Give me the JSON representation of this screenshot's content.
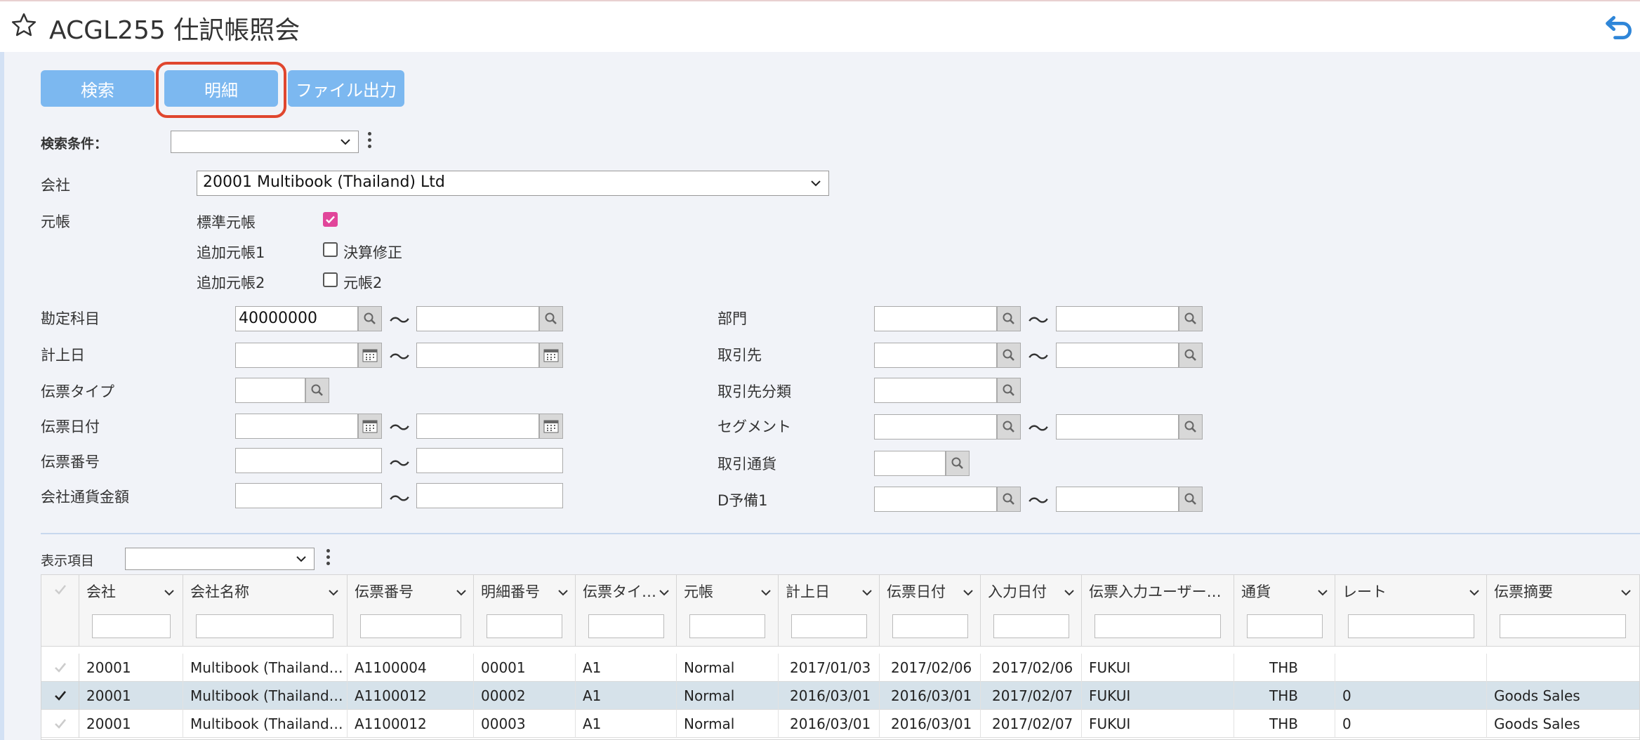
{
  "header": {
    "title": "ACGL255 仕訳帳照会"
  },
  "toolbar": {
    "search": "検索",
    "detail": "明細",
    "export": "ファイル出力"
  },
  "criteria": {
    "label": "検索条件：",
    "value": ""
  },
  "company": {
    "label": "会社",
    "value": "20001 Multibook (Thailand) Ltd"
  },
  "ledger": {
    "label": "元帳",
    "rows": [
      {
        "name": "標準元帳",
        "option": "",
        "checked": true
      },
      {
        "name": "追加元帳1",
        "option": "決算修正",
        "checked": false
      },
      {
        "name": "追加元帳2",
        "option": "元帳2",
        "checked": false
      }
    ]
  },
  "filters_left": [
    {
      "label": "勘定科目",
      "from": "40000000",
      "to": "",
      "type": "lookup",
      "range": true
    },
    {
      "label": "計上日",
      "from": "",
      "to": "",
      "type": "date",
      "range": true
    },
    {
      "label": "伝票タイプ",
      "from": "",
      "type": "lookup",
      "range": false
    },
    {
      "label": "伝票日付",
      "from": "",
      "to": "",
      "type": "date",
      "range": true
    },
    {
      "label": "伝票番号",
      "from": "",
      "to": "",
      "type": "text",
      "range": true
    },
    {
      "label": "会社通貨金額",
      "from": "",
      "to": "",
      "type": "text",
      "range": true
    }
  ],
  "filters_right": [
    {
      "label": "部門",
      "range": true
    },
    {
      "label": "取引先",
      "range": true
    },
    {
      "label": "取引先分類",
      "range": false
    },
    {
      "label": "セグメント",
      "range": true
    },
    {
      "label": "取引通貨",
      "range": false
    },
    {
      "label": "D予備1",
      "range": true
    }
  ],
  "tilde": "〜",
  "display": {
    "label": "表示項目",
    "value": ""
  },
  "grid": {
    "columns": [
      "会社",
      "会社名称",
      "伝票番号",
      "明細番号",
      "伝票タイ…",
      "元帳",
      "計上日",
      "伝票日付",
      "入力日付",
      "伝票入力ユーザー…",
      "通貨",
      "レート",
      "伝票摘要"
    ],
    "rows": [
      {
        "selected": false,
        "cells": [
          "20001",
          "Multibook (Thailand…",
          "A1100004",
          "00001",
          "A1",
          "Normal",
          "2017/01/03",
          "2017/02/06",
          "2017/02/06",
          "FUKUI",
          "THB",
          "",
          ""
        ]
      },
      {
        "selected": true,
        "cells": [
          "20001",
          "Multibook (Thailand…",
          "A1100012",
          "00002",
          "A1",
          "Normal",
          "2016/03/01",
          "2016/03/01",
          "2017/02/07",
          "FUKUI",
          "THB",
          "0",
          "Goods Sales"
        ]
      },
      {
        "selected": false,
        "cells": [
          "20001",
          "Multibook (Thailand…",
          "A1100012",
          "00003",
          "A1",
          "Normal",
          "2016/03/01",
          "2016/03/01",
          "2017/02/07",
          "FUKUI",
          "THB",
          "0",
          "Goods Sales"
        ]
      }
    ]
  },
  "colors": {
    "accent": "#7cb8f0",
    "highlight": "#e0462e",
    "check": "#e1459a"
  }
}
